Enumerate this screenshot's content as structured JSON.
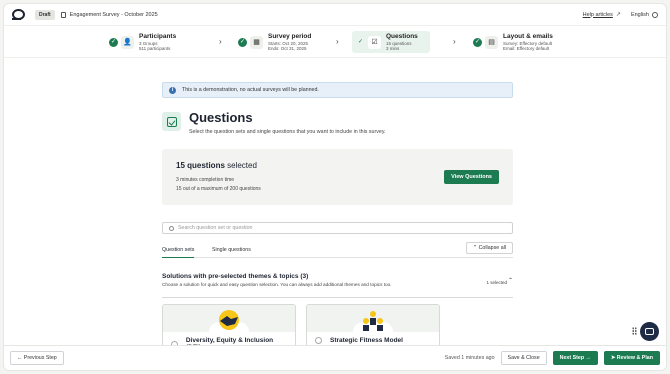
{
  "topbar": {
    "status_badge": "Draft",
    "survey_title": "Engagement Survey - October 2025",
    "help_link": "Help articles",
    "language": "English"
  },
  "stepper": [
    {
      "title": "Participants",
      "line1": "3 Groups",
      "line2": "511 participants",
      "icon": "participants-icon"
    },
    {
      "title": "Survey period",
      "line1": "Starts: Oct 20, 2025",
      "line2": "Ends: Oct 31, 2025",
      "icon": "calendar-icon"
    },
    {
      "title": "Questions",
      "line1": "15 questions",
      "line2": "3 mins",
      "icon": "checkbox-icon"
    },
    {
      "title": "Layout & emails",
      "line1": "Survey: Effectory default",
      "line2": "Email: Effectory default",
      "icon": "layout-icon"
    }
  ],
  "notice": "This is a demonstration, no actual surveys will be planned.",
  "header": {
    "title": "Questions",
    "description": "Select the question sets and single questions that you want to include in this survey."
  },
  "summary": {
    "count": "15 questions",
    "count_suffix": " selected",
    "line1": "3 minutes completion time",
    "line2": "15 out of a maximum of 200 questions",
    "view_button": "View Questions"
  },
  "search": {
    "placeholder": "Search question set or question"
  },
  "tabs": {
    "question_sets": "Question sets",
    "single_questions": "Single questions",
    "collapse_all": "Collapse all"
  },
  "section": {
    "title": "Solutions with pre-selected themes & topics (3)",
    "description": "Choose a solution for quick and easy question selection. You can always add additional themes and topics too.",
    "selected": "1 selected"
  },
  "cards": [
    {
      "name": "Diversity, Equity & Inclusion (DEI)"
    },
    {
      "name": "Strategic Fitness Model"
    }
  ],
  "bottom": {
    "previous": "Previous Step",
    "saved": "Saved 1 minutes ago",
    "save_close": "Save & Close",
    "next": "Next Step",
    "review": "Review & Plan"
  },
  "colors": {
    "accent": "#1d7b52",
    "navy": "#1f2a44",
    "info": "#3a6fb0"
  }
}
